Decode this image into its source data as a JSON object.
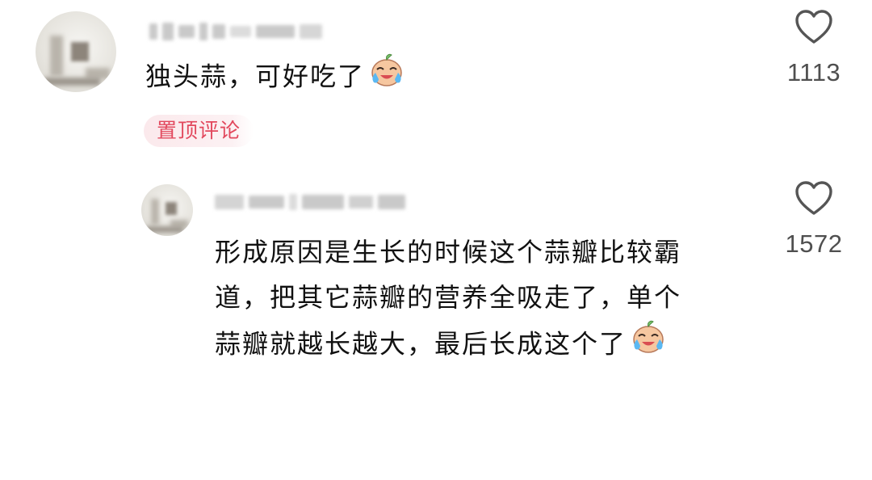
{
  "comments": [
    {
      "text": "独头蒜，可好吃了",
      "emoji": "crying-laughing-emoji",
      "likes": "1113",
      "pinned_label": "置顶评论"
    },
    {
      "text_lines": [
        "形成原因是生长的时候这个蒜瓣比较霸",
        "道，把其它蒜瓣的营养全吸走了，单个",
        "蒜瓣就越长越大，最后长成这个了"
      ],
      "emoji": "crying-laughing-emoji",
      "likes": "1572"
    }
  ],
  "icons": {
    "like": "heart-outline-icon"
  },
  "colors": {
    "pin_tag_text": "#e2485d",
    "pin_tag_bg": "#fbe9ec",
    "like_count": "#4f4f4f"
  }
}
